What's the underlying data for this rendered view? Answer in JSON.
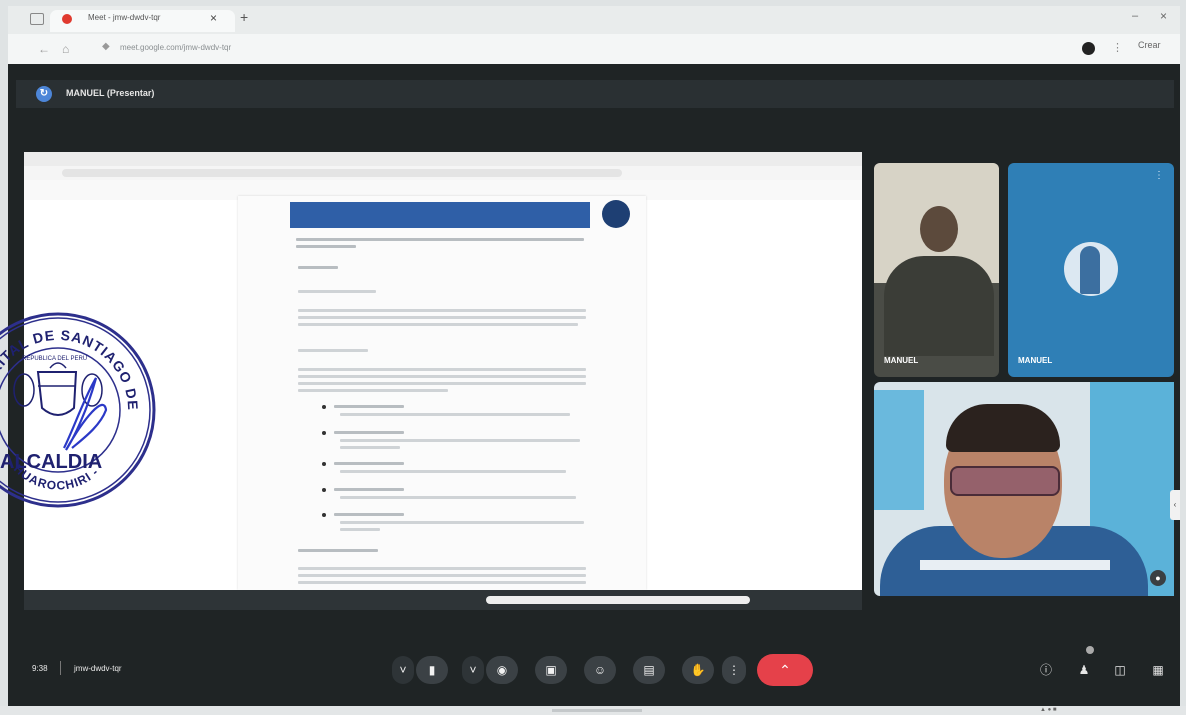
{
  "browser": {
    "tab_title": "Meet - jmw-dwdv-tqr",
    "tab_close": "×",
    "new_tab": "+",
    "url": "meet.google.com/jmw-dwdv-tqr",
    "profile": "Crear",
    "minimize": "–",
    "close": "×"
  },
  "meeting": {
    "presenter_banner": "MANUEL (Presentar)",
    "time": "9:38",
    "meeting_code": "jmw-dwdv-tqr",
    "participants": [
      {
        "name": "MANUEL"
      },
      {
        "name": "MANUEL"
      }
    ],
    "controls": {
      "end_call": "⌃"
    }
  },
  "seal": {
    "arc_top": "DISTRITAL DE SANTIAGO DE TUNA",
    "arc_bottom": "HUAROCHIRI - LIMA",
    "center": "ALCALDIA",
    "inner_ring": "REPUBLICA DEL PERU"
  },
  "colors": {
    "meeting_bg": "#1f2425",
    "end_call": "#e5414a",
    "participant_tile": "#2f7fb6",
    "seal_ink": "#2d2f8c",
    "signature_ink": "#2b39c7"
  },
  "icons": [
    "microphone-icon",
    "camera-icon",
    "captions-icon",
    "emoji-icon",
    "present-icon",
    "raise-hand-icon",
    "more-options-icon",
    "end-call-icon",
    "info-icon",
    "people-icon",
    "chat-icon",
    "activities-icon"
  ]
}
